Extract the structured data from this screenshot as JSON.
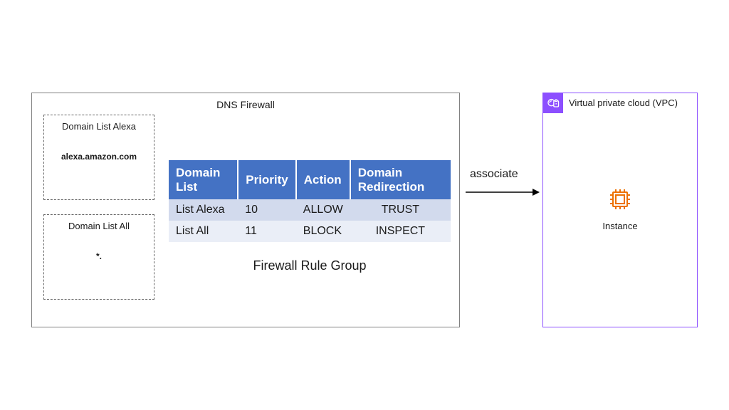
{
  "firewall": {
    "title": "DNS Firewall",
    "domain_lists": {
      "alexa": {
        "title": "Domain List Alexa",
        "content": "alexa.amazon.com"
      },
      "all": {
        "title": "Domain List All",
        "content": "*."
      }
    },
    "table": {
      "headers": {
        "c0": "Domain List",
        "c1": "Priority",
        "c2": "Action",
        "c3": "Domain Redirection"
      },
      "rows": {
        "r0": {
          "c0": "List Alexa",
          "c1": "10",
          "c2": "ALLOW",
          "c3": "TRUST"
        },
        "r1": {
          "c0": "List All",
          "c1": "11",
          "c2": "BLOCK",
          "c3": "INSPECT"
        }
      },
      "caption": "Firewall Rule Group"
    }
  },
  "associate_label": "associate",
  "vpc": {
    "label": "Virtual private cloud (VPC)",
    "instance_label": "Instance"
  },
  "colors": {
    "table_header": "#4472c4",
    "vpc_border": "#8C4FFF",
    "instance_icon": "#ED7100"
  }
}
